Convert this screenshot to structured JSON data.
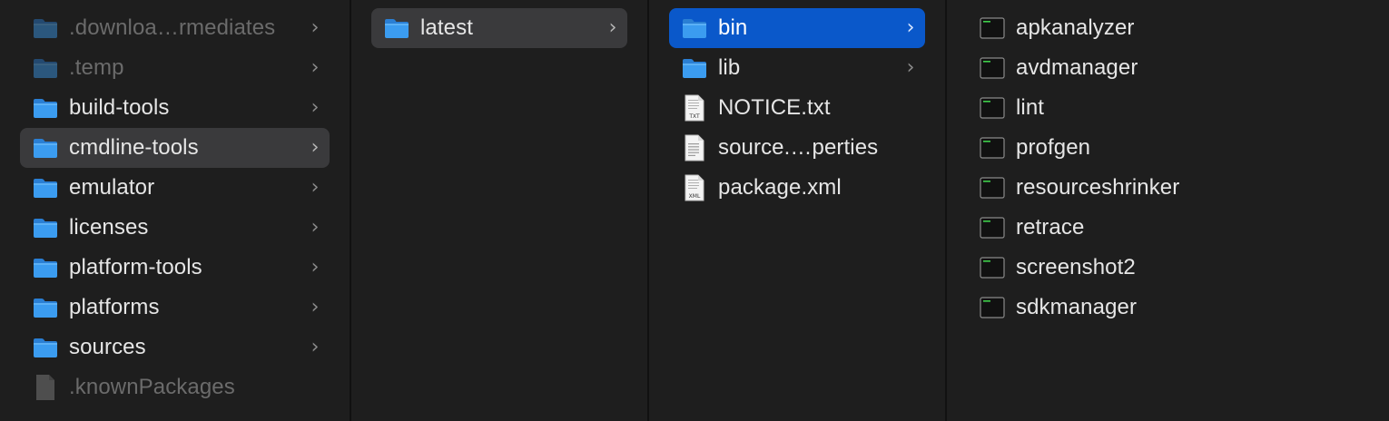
{
  "columns": [
    {
      "id": "col1",
      "items": [
        {
          "label": ".downloa…rmediates",
          "icon": "folder-icon",
          "kind": "folder",
          "hidden": true,
          "has_children": true
        },
        {
          "label": ".temp",
          "icon": "folder-icon",
          "kind": "folder",
          "hidden": true,
          "has_children": true
        },
        {
          "label": "build-tools",
          "icon": "folder-icon",
          "kind": "folder",
          "has_children": true
        },
        {
          "label": "cmdline-tools",
          "icon": "folder-icon",
          "kind": "folder",
          "has_children": true,
          "selected": "gray"
        },
        {
          "label": "emulator",
          "icon": "folder-icon",
          "kind": "folder",
          "has_children": true
        },
        {
          "label": "licenses",
          "icon": "folder-icon",
          "kind": "folder",
          "has_children": true
        },
        {
          "label": "platform-tools",
          "icon": "folder-icon",
          "kind": "folder",
          "has_children": true
        },
        {
          "label": "platforms",
          "icon": "folder-icon",
          "kind": "folder",
          "has_children": true
        },
        {
          "label": "sources",
          "icon": "folder-icon",
          "kind": "folder",
          "has_children": true
        },
        {
          "label": ".knownPackages",
          "icon": "blank-document-icon",
          "kind": "doc",
          "hidden": true
        }
      ]
    },
    {
      "id": "col2",
      "items": [
        {
          "label": "latest",
          "icon": "folder-icon",
          "kind": "folder",
          "has_children": true,
          "selected": "gray"
        }
      ]
    },
    {
      "id": "col3",
      "items": [
        {
          "label": "bin",
          "icon": "folder-icon",
          "kind": "folder",
          "has_children": true,
          "selected": "blue"
        },
        {
          "label": "lib",
          "icon": "folder-icon",
          "kind": "folder",
          "has_children": true
        },
        {
          "label": "NOTICE.txt",
          "icon": "txt-document-icon",
          "kind": "txt",
          "badge": "TXT"
        },
        {
          "label": "source.…perties",
          "icon": "text-document-icon",
          "kind": "doc"
        },
        {
          "label": "package.xml",
          "icon": "xml-document-icon",
          "kind": "txt",
          "badge": "XML"
        }
      ]
    },
    {
      "id": "col4",
      "items": [
        {
          "label": "apkanalyzer",
          "icon": "terminal-executable-icon",
          "kind": "exec"
        },
        {
          "label": "avdmanager",
          "icon": "terminal-executable-icon",
          "kind": "exec"
        },
        {
          "label": "lint",
          "icon": "terminal-executable-icon",
          "kind": "exec"
        },
        {
          "label": "profgen",
          "icon": "terminal-executable-icon",
          "kind": "exec"
        },
        {
          "label": "resourceshrinker",
          "icon": "terminal-executable-icon",
          "kind": "exec"
        },
        {
          "label": "retrace",
          "icon": "terminal-executable-icon",
          "kind": "exec"
        },
        {
          "label": "screenshot2",
          "icon": "terminal-executable-icon",
          "kind": "exec"
        },
        {
          "label": "sdkmanager",
          "icon": "terminal-executable-icon",
          "kind": "exec"
        }
      ]
    }
  ],
  "colors": {
    "background": "#1e1e1e",
    "selection_gray": "#3a3a3c",
    "selection_blue": "#0a58ca",
    "folder_blue": "#3b9cf0",
    "text": "#e6e6e6",
    "hidden_text": "#6b6b6b"
  },
  "chevron_glyph": "›"
}
